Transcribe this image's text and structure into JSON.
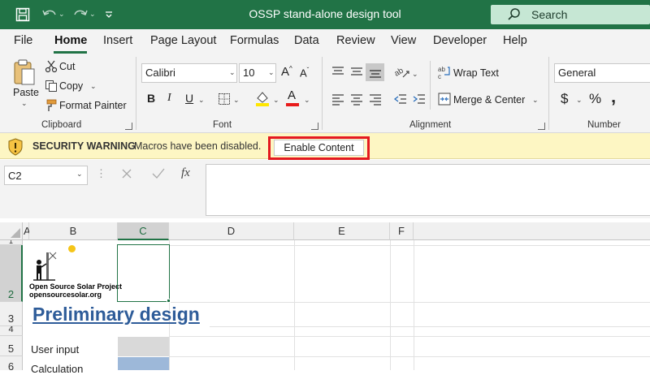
{
  "window": {
    "title": "OSSP stand-alone design tool"
  },
  "search": {
    "label": "Search"
  },
  "menu": {
    "tabs": [
      {
        "label": "File"
      },
      {
        "label": "Home"
      },
      {
        "label": "Insert"
      },
      {
        "label": "Page Layout"
      },
      {
        "label": "Formulas"
      },
      {
        "label": "Data"
      },
      {
        "label": "Review"
      },
      {
        "label": "View"
      },
      {
        "label": "Developer"
      },
      {
        "label": "Help"
      }
    ],
    "active": "Home"
  },
  "ribbon": {
    "clipboard": {
      "label": "Clipboard",
      "paste": "Paste",
      "cut": "Cut",
      "copy": "Copy",
      "format_painter": "Format Painter"
    },
    "font": {
      "label": "Font",
      "font_name": "Calibri",
      "font_size": "10",
      "bold": "B",
      "italic": "I",
      "underline": "U"
    },
    "alignment": {
      "label": "Alignment",
      "wrap_text": "Wrap Text",
      "merge_center": "Merge & Center"
    },
    "number": {
      "label": "Number",
      "format": "General",
      "currency": "$",
      "percent": "%",
      "comma": "‚"
    }
  },
  "security": {
    "title": "SECURITY WARNING",
    "message": "Macros have been disabled.",
    "button": "Enable Content"
  },
  "formula_bar": {
    "name_box": "C2",
    "fx": "fx",
    "formula": ""
  },
  "sheet": {
    "columns": [
      "A",
      "B",
      "C",
      "D",
      "E",
      "F"
    ],
    "selected_column": "C",
    "rows": [
      "1",
      "2",
      "3",
      "4",
      "5",
      "6"
    ],
    "selected_row": "2",
    "logo_line1": "Open Source Solar Project",
    "logo_line2": "opensourcesolar.org",
    "heading": "Preliminary design",
    "user_input_label": "User input",
    "calculation_label": "Calculation",
    "colors": {
      "user_input": "#d9d9d9",
      "calculation": "#9db8d9",
      "heading": "#2e5c99",
      "accent": "#217346"
    }
  }
}
